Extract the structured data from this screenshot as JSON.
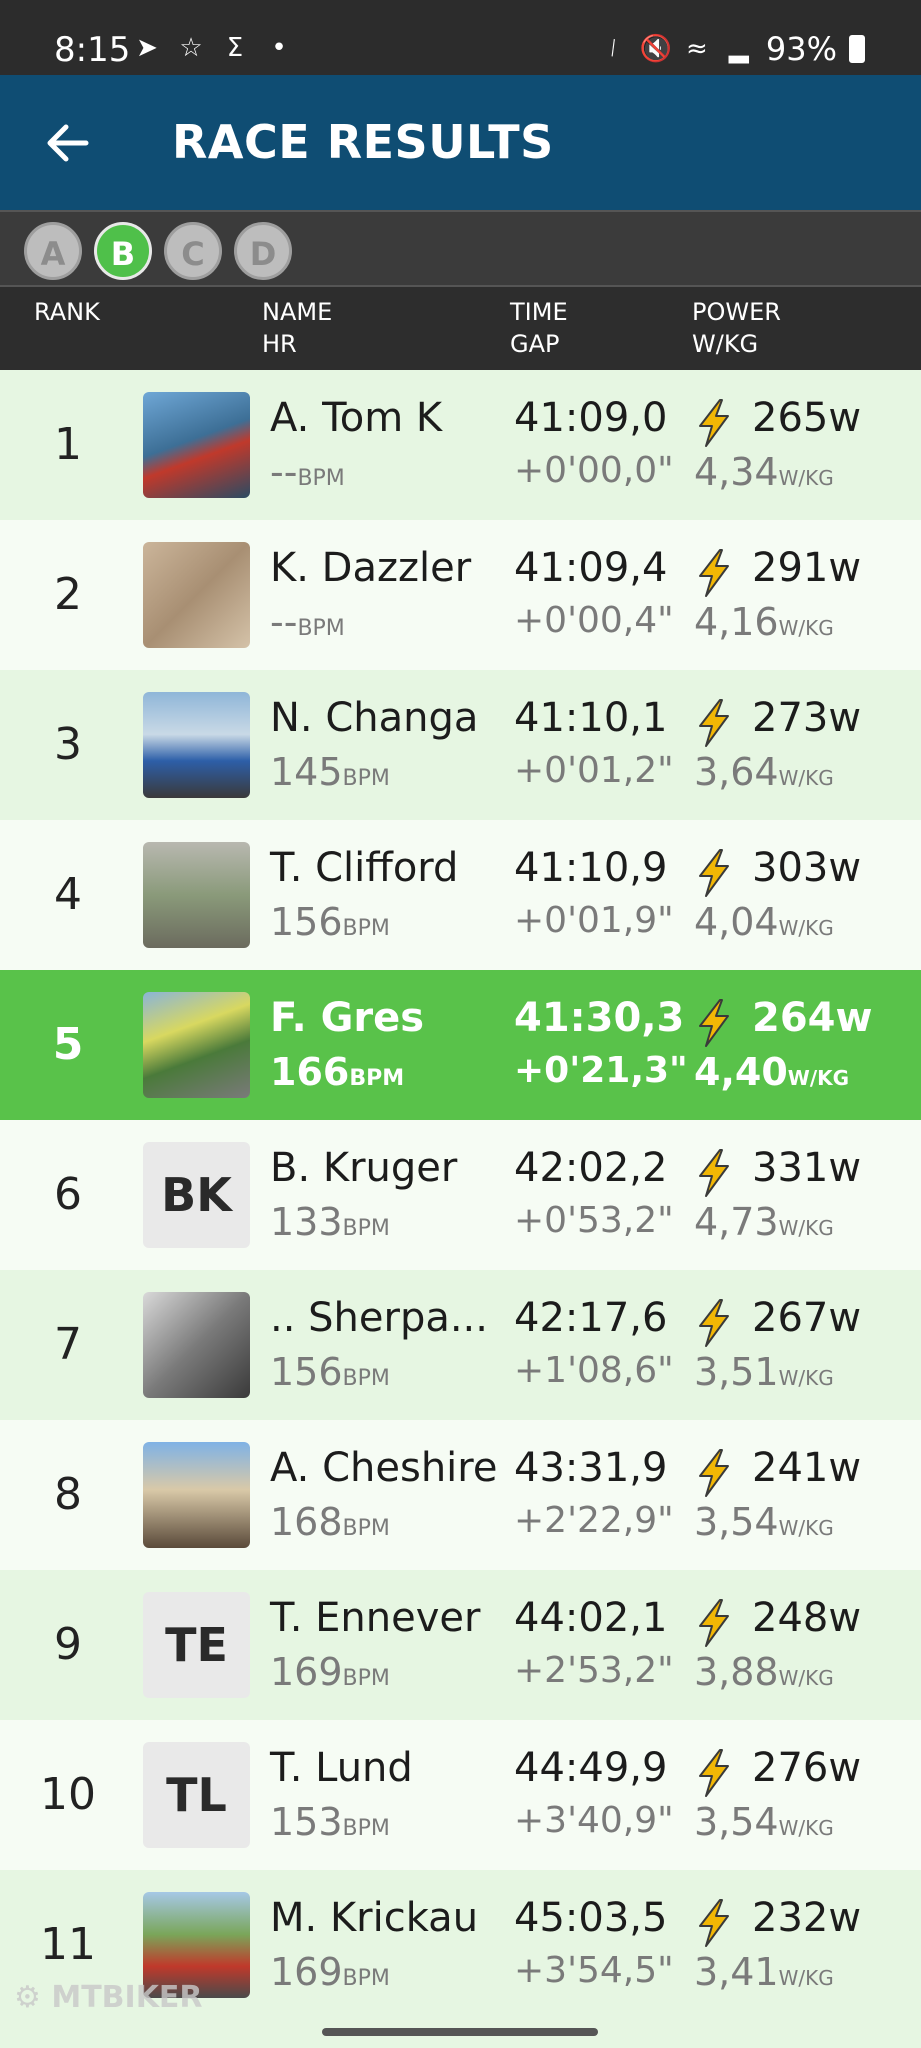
{
  "status_bar": {
    "time": "8:15",
    "battery": "93%",
    "left_icons": [
      "navigation-icon",
      "snapchat-icon",
      "sigma-app-icon",
      "dot-icon"
    ],
    "right_icons": [
      "bluetooth-icon",
      "mute-icon",
      "wifi-icon",
      "signal-icon",
      "battery-icon"
    ]
  },
  "header": {
    "title": "RACE RESULTS"
  },
  "categories": [
    {
      "label": "A",
      "active": false
    },
    {
      "label": "B",
      "active": true
    },
    {
      "label": "C",
      "active": false
    },
    {
      "label": "D",
      "active": false
    }
  ],
  "columns": {
    "rank": "RANK",
    "name": "NAME",
    "hr": "HR",
    "time": "TIME",
    "gap": "GAP",
    "power": "POWER",
    "wkg": "W/KG"
  },
  "units": {
    "bpm": "BPM",
    "wkg": "W/KG"
  },
  "results": [
    {
      "rank": "1",
      "name": "A. Tom   K",
      "hr": "--",
      "time": "41:09,0",
      "gap": "+0'00,0\"",
      "watts": "265w",
      "wkg": "4,34",
      "avatar": "photo-kayak",
      "initials": ""
    },
    {
      "rank": "2",
      "name": "K. Dazzler",
      "hr": "--",
      "time": "41:09,4",
      "gap": "+0'00,4\"",
      "watts": "291w",
      "wkg": "4,16",
      "avatar": "photo-sketch",
      "initials": ""
    },
    {
      "rank": "3",
      "name": "N. Changa",
      "hr": "145",
      "time": "41:10,1",
      "gap": "+0'01,2\"",
      "watts": "273w",
      "wkg": "3,64",
      "avatar": "photo-cyclists",
      "initials": ""
    },
    {
      "rank": "4",
      "name": "T. Clifford",
      "hr": "156",
      "time": "41:10,9",
      "gap": "+0'01,9\"",
      "watts": "303w",
      "wkg": "4,04",
      "avatar": "photo-road",
      "initials": ""
    },
    {
      "rank": "5",
      "name": "F. Gres",
      "hr": "166",
      "time": "41:30,3",
      "gap": "+0'21,3\"",
      "watts": "264w",
      "wkg": "4,40",
      "avatar": "photo-rider",
      "initials": "",
      "highlight": true
    },
    {
      "rank": "6",
      "name": "B. Kruger",
      "hr": "133",
      "time": "42:02,2",
      "gap": "+0'53,2\"",
      "watts": "331w",
      "wkg": "4,73",
      "avatar": "initials",
      "initials": "BK"
    },
    {
      "rank": "7",
      "name": ".. Sherpa...",
      "hr": "156",
      "time": "42:17,6",
      "gap": "+1'08,6\"",
      "watts": "267w",
      "wkg": "3,51",
      "avatar": "photo-bw",
      "initials": ""
    },
    {
      "rank": "8",
      "name": "A. Cheshire",
      "hr": "168",
      "time": "43:31,9",
      "gap": "+2'22,9\"",
      "watts": "241w",
      "wkg": "3,54",
      "avatar": "photo-city",
      "initials": ""
    },
    {
      "rank": "9",
      "name": "T. Ennever",
      "hr": "169",
      "time": "44:02,1",
      "gap": "+2'53,2\"",
      "watts": "248w",
      "wkg": "3,88",
      "avatar": "initials",
      "initials": "TE"
    },
    {
      "rank": "10",
      "name": "T. Lund",
      "hr": "153",
      "time": "44:49,9",
      "gap": "+3'40,9\"",
      "watts": "276w",
      "wkg": "3,54",
      "avatar": "initials",
      "initials": "TL"
    },
    {
      "rank": "11",
      "name": "M. Krickau",
      "hr": "169",
      "time": "45:03,5",
      "gap": "+3'54,5\"",
      "watts": "232w",
      "wkg": "3,41",
      "avatar": "photo-mountain",
      "initials": ""
    }
  ],
  "watermark": "MTBIKER",
  "colors": {
    "header": "#0f4d73",
    "highlight": "#59c24a",
    "bolt": "#f2b705",
    "row_odd": "#e6f6e2",
    "row_even": "#f6fcf4"
  }
}
